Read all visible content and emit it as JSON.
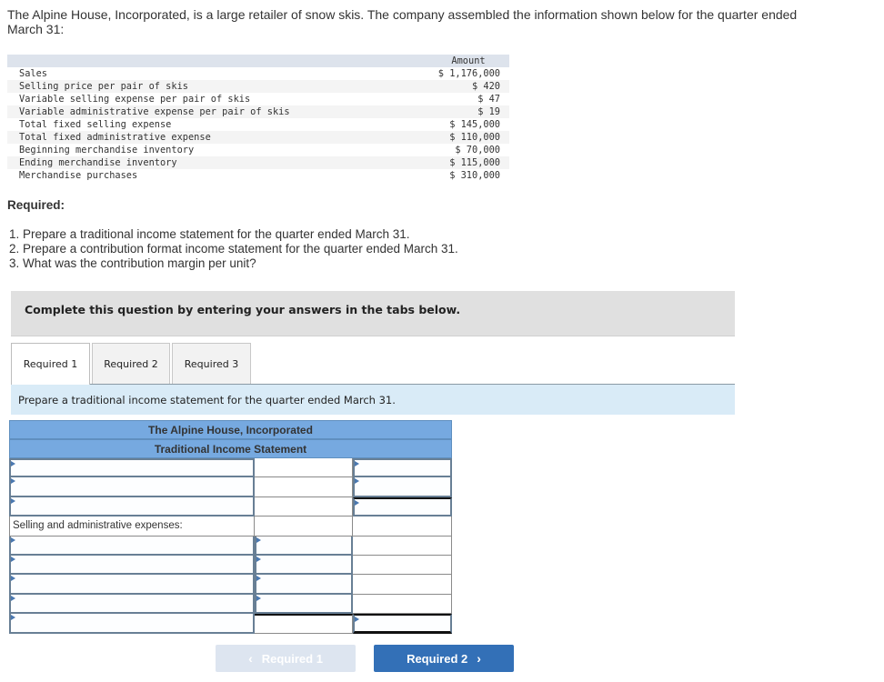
{
  "intro": "The Alpine House, Incorporated, is a large retailer of snow skis. The company assembled the information shown below for the quarter ended March 31:",
  "given_table": {
    "amount_header": "Amount",
    "rows": [
      {
        "label": "Sales",
        "value": "$ 1,176,000"
      },
      {
        "label": "Selling price per pair of skis",
        "value": "$ 420"
      },
      {
        "label": "Variable selling expense per pair of skis",
        "value": "$ 47"
      },
      {
        "label": "Variable administrative expense per pair of skis",
        "value": "$ 19"
      },
      {
        "label": "Total fixed selling expense",
        "value": "$ 145,000"
      },
      {
        "label": "Total fixed administrative expense",
        "value": "$ 110,000"
      },
      {
        "label": "Beginning merchandise inventory",
        "value": "$ 70,000"
      },
      {
        "label": "Ending merchandise inventory",
        "value": "$ 115,000"
      },
      {
        "label": "Merchandise purchases",
        "value": "$ 310,000"
      }
    ]
  },
  "required": {
    "title": "Required:",
    "items": [
      "1. Prepare a traditional income statement for the quarter ended March 31.",
      "2. Prepare a contribution format income statement for the quarter ended March 31.",
      "3. What was the contribution margin per unit?"
    ]
  },
  "complete_banner": "Complete this question by entering your answers in the tabs below.",
  "tabs": [
    {
      "label": "Required 1",
      "active": true
    },
    {
      "label": "Required 2",
      "active": false
    },
    {
      "label": "Required 3",
      "active": false
    }
  ],
  "instruction": "Prepare a traditional income statement for the quarter ended March 31.",
  "statement": {
    "company": "The Alpine House, Incorporated",
    "title": "Traditional Income Statement",
    "section_label": "Selling and administrative expenses:",
    "rows": [
      {
        "label": "",
        "amount": "",
        "total": ""
      },
      {
        "label": "",
        "amount": "",
        "total": ""
      },
      {
        "label": "",
        "amount": "",
        "total": ""
      },
      {
        "label": "",
        "amount": "",
        "total": ""
      },
      {
        "label": "",
        "amount": "",
        "total": ""
      },
      {
        "label": "",
        "amount": "",
        "total": ""
      },
      {
        "label": "",
        "amount": "",
        "total": ""
      },
      {
        "label": "",
        "amount": "",
        "total": ""
      }
    ]
  },
  "nav": {
    "prev_label": "Required 1",
    "next_label": "Required 2",
    "prev_icon": "chevron-left-icon",
    "next_icon": "chevron-right-icon"
  }
}
